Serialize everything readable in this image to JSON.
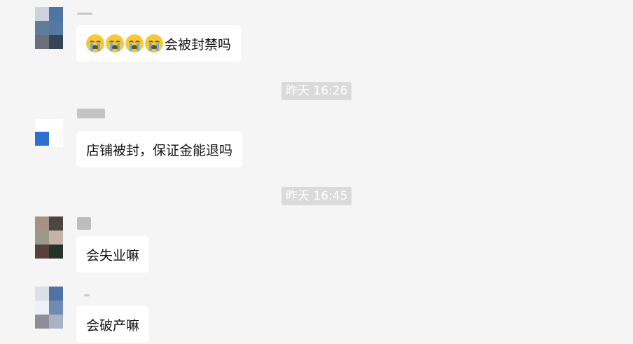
{
  "messages": [
    {
      "text": "会被封禁吗",
      "emoji": "crying-face-icon",
      "emoji_count": 4
    },
    {
      "text": "店铺被封，保证金能退吗"
    },
    {
      "text": "会失业嘛"
    },
    {
      "text": "会破产嘛"
    }
  ],
  "timestamps": [
    "昨天 16:26",
    "昨天 16:45"
  ],
  "colors": {
    "background": "#f5f5f5",
    "bubble": "#ffffff",
    "timestamp_badge": "#dadada"
  }
}
